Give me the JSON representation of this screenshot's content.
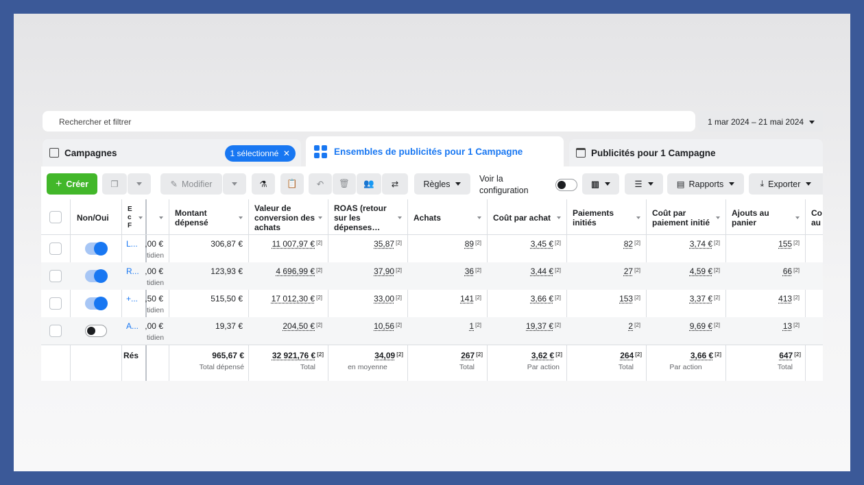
{
  "search": {
    "placeholder": "Rechercher et filtrer"
  },
  "date_range": "1 mar 2024 – 21 mai 2024",
  "tabs": {
    "campaigns": "Campagnes",
    "selected_badge": "1 sélectionné",
    "adsets": "Ensembles de publicités pour 1 Campagne",
    "ads": "Publicités pour 1 Campagne"
  },
  "toolbar": {
    "create": "Créer",
    "modify": "Modifier",
    "rules": "Règles",
    "view_config": [
      "Voir la",
      "configuration"
    ],
    "reports": "Rapports",
    "export": "Exporter"
  },
  "headers": {
    "toggle": "Non/Oui",
    "col_e": [
      "E",
      "c",
      "F"
    ],
    "spent": [
      "Montant",
      "dépensé"
    ],
    "conv_value": [
      "Valeur de",
      "conversion des",
      "achats"
    ],
    "roas": [
      "ROAS (retour",
      "sur les",
      "dépenses…"
    ],
    "purchases": [
      "Achats"
    ],
    "cpp": [
      "Coût par achat"
    ],
    "checkouts": [
      "Paiements",
      "initiés"
    ],
    "cpc": [
      "Coût par",
      "paiement initié"
    ],
    "carts": [
      "Ajouts au",
      "panier"
    ],
    "next": [
      "Co",
      "au"
    ]
  },
  "rows": [
    {
      "on": true,
      "name": "L...",
      "budget": ",00 €",
      "budget_sub": "tidien",
      "spent": "306,87 €",
      "conv": "11 007,97 €",
      "roas": "35,87",
      "purch": "89",
      "cpp": "3,45 €",
      "chk": "82",
      "cpc": "3,74 €",
      "cart": "155"
    },
    {
      "on": true,
      "name": "R...",
      "budget": ",00 €",
      "budget_sub": "tidien",
      "spent": "123,93 €",
      "conv": "4 696,99 €",
      "roas": "37,90",
      "purch": "36",
      "cpp": "3,44 €",
      "chk": "27",
      "cpc": "4,59 €",
      "cart": "66"
    },
    {
      "on": true,
      "name": "+...",
      "budget": ",50 €",
      "budget_sub": "tidien",
      "spent": "515,50 €",
      "conv": "17 012,30 €",
      "roas": "33,00",
      "purch": "141",
      "cpp": "3,66 €",
      "chk": "153",
      "cpc": "3,37 €",
      "cart": "413"
    },
    {
      "on": false,
      "name": "A...",
      "budget": ",00 €",
      "budget_sub": "tidien",
      "spent": "19,37 €",
      "conv": "204,50 €",
      "roas": "10,56",
      "purch": "1",
      "cpp": "19,37 €",
      "chk": "2",
      "cpc": "9,69 €",
      "cart": "13"
    }
  ],
  "footnote": "[2]",
  "totals": {
    "label": "Rés",
    "spent": "965,67 €",
    "spent_sub": "Total dépensé",
    "conv": "32 921,76 €",
    "conv_sub": "Total",
    "roas": "34,09",
    "roas_sub": "en moyenne",
    "purch": "267",
    "purch_sub": "Total",
    "cpp": "3,62 €",
    "cpp_sub": "Par action",
    "chk": "264",
    "chk_sub": "Total",
    "cpc": "3,66 €",
    "cpc_sub": "Par action",
    "cart": "647",
    "cart_sub": "Total"
  }
}
